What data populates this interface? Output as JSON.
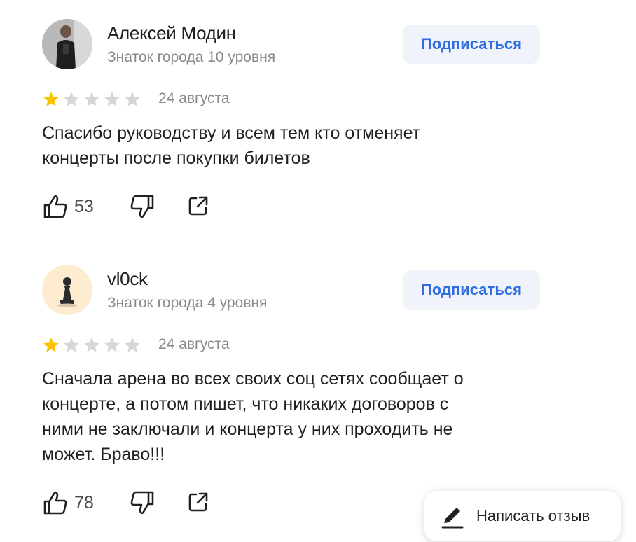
{
  "reviews": [
    {
      "author": "Алексей Модин",
      "level": "Знаток города 10 уровня",
      "subscribe_label": "Подписаться",
      "rating": 1,
      "date": "24 августа",
      "text_lines": [
        "Спасибо руководству и всем тем кто отменяет",
        "концерты после покупки билетов"
      ],
      "likes": "53"
    },
    {
      "author": "vl0ck",
      "level": "Знаток города 4 уровня",
      "subscribe_label": "Подписаться",
      "rating": 1,
      "date": "24 августа",
      "text_lines": [
        "Сначала арена во всех своих соц сетях сообщает о",
        "концерте, а потом пишет, что никаких договоров с",
        "ними не заключали и концерта у них проходить не",
        "может. Браво!!!"
      ],
      "likes": "78"
    }
  ],
  "write_review_label": "Написать отзыв",
  "colors": {
    "star_filled": "#fcc300",
    "star_empty": "#d7d7d7",
    "accent": "#2f6de1"
  }
}
